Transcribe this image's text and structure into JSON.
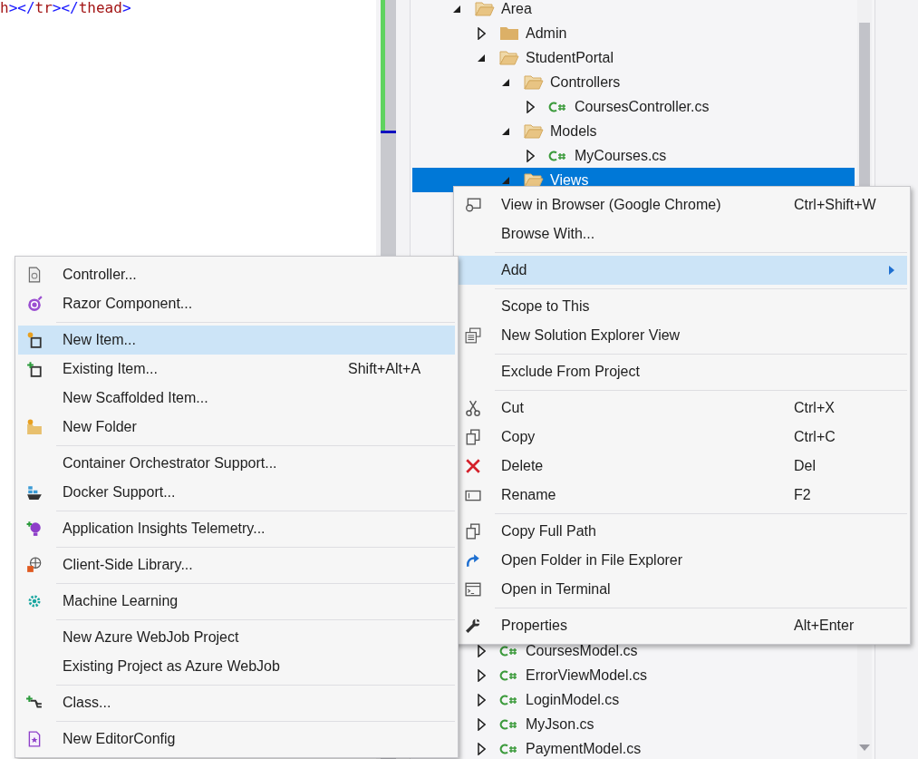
{
  "editor": {
    "code_line": [
      {
        "kind": "tag",
        "text": "h"
      },
      {
        "kind": "punct",
        "text": "></"
      },
      {
        "kind": "tag",
        "text": "tr"
      },
      {
        "kind": "punct",
        "text": "></"
      },
      {
        "kind": "tag",
        "text": "thead"
      },
      {
        "kind": "punct",
        "text": ">"
      }
    ]
  },
  "solution_explorer": {
    "items": [
      {
        "label": "Area",
        "kind": "folder",
        "expanded": true,
        "selected": false,
        "children": [
          {
            "label": "Admin",
            "kind": "folder",
            "expanded": false,
            "selected": false
          },
          {
            "label": "StudentPortal",
            "kind": "folder",
            "expanded": true,
            "selected": false,
            "children": [
              {
                "label": "Controllers",
                "kind": "folder",
                "expanded": true,
                "selected": false,
                "children": [
                  {
                    "label": "CoursesController.cs",
                    "kind": "csharp",
                    "expanded": false,
                    "selected": false
                  }
                ]
              },
              {
                "label": "Models",
                "kind": "folder",
                "expanded": true,
                "selected": false,
                "children": [
                  {
                    "label": "MyCourses.cs",
                    "kind": "csharp",
                    "expanded": false,
                    "selected": false
                  }
                ]
              },
              {
                "label": "Views",
                "kind": "folder",
                "expanded": true,
                "selected": true
              }
            ]
          }
        ]
      }
    ],
    "lower_items": [
      {
        "label": "CoursesModel.cs",
        "kind": "csharp",
        "expanded": false,
        "selected": false
      },
      {
        "label": "ErrorViewModel.cs",
        "kind": "csharp",
        "expanded": false,
        "selected": false
      },
      {
        "label": "LoginModel.cs",
        "kind": "csharp",
        "expanded": false,
        "selected": false
      },
      {
        "label": "MyJson.cs",
        "kind": "csharp",
        "expanded": false,
        "selected": false
      },
      {
        "label": "PaymentModel.cs",
        "kind": "csharp",
        "expanded": false,
        "selected": false
      }
    ]
  },
  "context_menu": {
    "items": [
      {
        "kind": "item",
        "label": "View in Browser (Google Chrome)",
        "shortcut": "Ctrl+Shift+W",
        "selected": false
      },
      {
        "kind": "item",
        "label": "Browse With...",
        "selected": false
      },
      {
        "kind": "separator"
      },
      {
        "kind": "item",
        "label": "Add",
        "submenu": true,
        "selected": true
      },
      {
        "kind": "separator"
      },
      {
        "kind": "item",
        "label": "Scope to This",
        "selected": false
      },
      {
        "kind": "item",
        "label": "New Solution Explorer View",
        "selected": false
      },
      {
        "kind": "separator"
      },
      {
        "kind": "item",
        "label": "Exclude From Project",
        "selected": false
      },
      {
        "kind": "separator"
      },
      {
        "kind": "item",
        "label": "Cut",
        "shortcut": "Ctrl+X",
        "selected": false
      },
      {
        "kind": "item",
        "label": "Copy",
        "shortcut": "Ctrl+C",
        "selected": false
      },
      {
        "kind": "item",
        "label": "Delete",
        "shortcut": "Del",
        "selected": false
      },
      {
        "kind": "item",
        "label": "Rename",
        "shortcut": "F2",
        "selected": false
      },
      {
        "kind": "separator"
      },
      {
        "kind": "item",
        "label": "Copy Full Path",
        "selected": false
      },
      {
        "kind": "item",
        "label": "Open Folder in File Explorer",
        "selected": false
      },
      {
        "kind": "item",
        "label": "Open in Terminal",
        "selected": false
      },
      {
        "kind": "separator"
      },
      {
        "kind": "item",
        "label": "Properties",
        "shortcut": "Alt+Enter",
        "selected": false
      }
    ]
  },
  "add_submenu": {
    "items": [
      {
        "kind": "item",
        "label": "Controller...",
        "selected": false
      },
      {
        "kind": "item",
        "label": "Razor Component...",
        "selected": false
      },
      {
        "kind": "separator"
      },
      {
        "kind": "item",
        "label": "New Item...",
        "selected": true
      },
      {
        "kind": "item",
        "label": "Existing Item...",
        "shortcut": "Shift+Alt+A",
        "selected": false
      },
      {
        "kind": "item",
        "label": "New Scaffolded Item...",
        "selected": false
      },
      {
        "kind": "item",
        "label": "New Folder",
        "selected": false
      },
      {
        "kind": "separator"
      },
      {
        "kind": "item",
        "label": "Container Orchestrator Support...",
        "selected": false
      },
      {
        "kind": "item",
        "label": "Docker Support...",
        "selected": false
      },
      {
        "kind": "separator"
      },
      {
        "kind": "item",
        "label": "Application Insights Telemetry...",
        "selected": false
      },
      {
        "kind": "separator"
      },
      {
        "kind": "item",
        "label": "Client-Side Library...",
        "selected": false
      },
      {
        "kind": "separator"
      },
      {
        "kind": "item",
        "label": "Machine Learning",
        "selected": false
      },
      {
        "kind": "separator"
      },
      {
        "kind": "item",
        "label": "New Azure WebJob Project",
        "selected": false
      },
      {
        "kind": "item",
        "label": "Existing Project as Azure WebJob",
        "selected": false
      },
      {
        "kind": "separator"
      },
      {
        "kind": "item",
        "label": "Class...",
        "selected": false
      },
      {
        "kind": "separator"
      },
      {
        "kind": "item",
        "label": "New EditorConfig",
        "selected": false
      }
    ]
  }
}
